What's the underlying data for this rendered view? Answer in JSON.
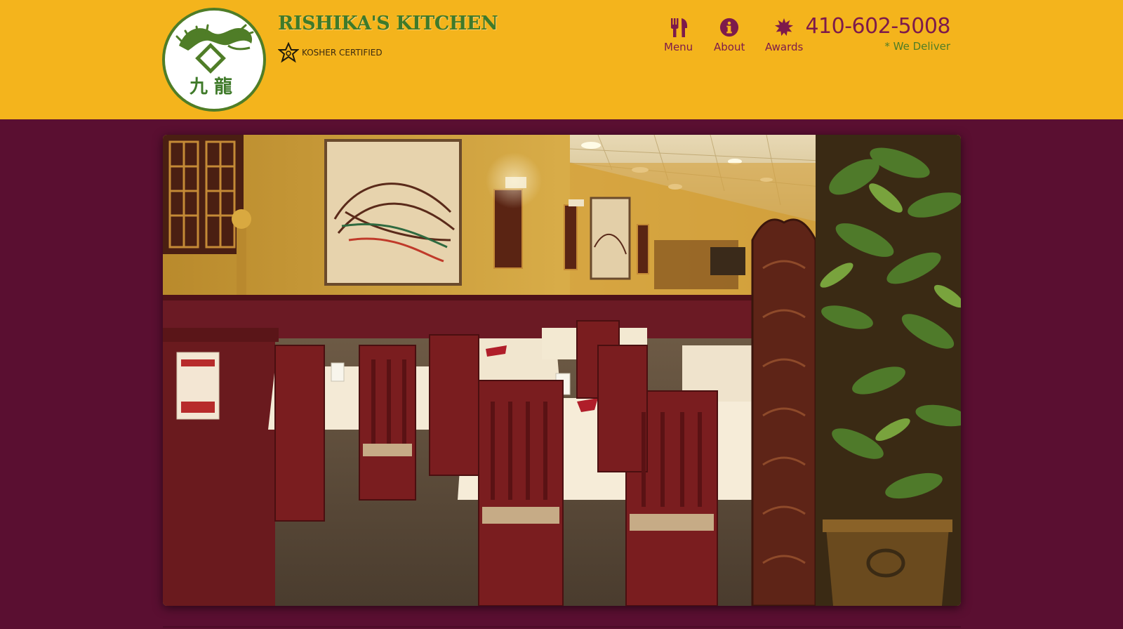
{
  "header": {
    "title": "RISHIKA'S KITCHEN",
    "kosher_label": "KOSHER CERTIFIED",
    "phone": "410-602-5008",
    "deliver_note": "* We Deliver",
    "logo_characters": "九 龍"
  },
  "nav": {
    "items": [
      {
        "label": "Menu",
        "icon": "utensils-icon"
      },
      {
        "label": "About",
        "icon": "info-circle-icon"
      },
      {
        "label": "Awards",
        "icon": "starburst-icon"
      }
    ]
  },
  "hero": {
    "description_icon": "restaurant-dining-room-photo"
  },
  "colors": {
    "header_bg": "#f4b41c",
    "page_bg": "#5a0f31",
    "brand_green": "#3f7a2a",
    "accent_maroon": "#7d1a4b"
  }
}
